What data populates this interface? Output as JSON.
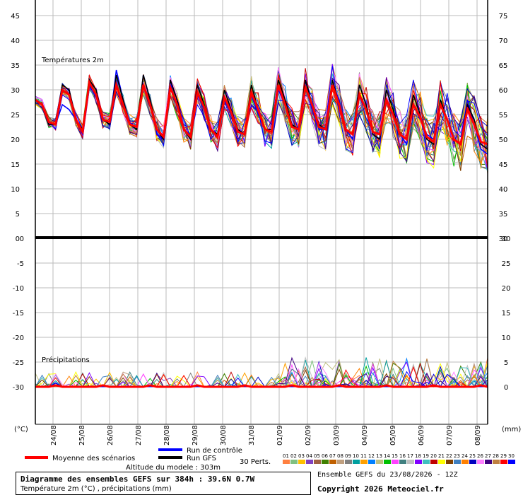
{
  "chart_data": [
    {
      "type": "line",
      "title": "Températures 2m",
      "ylim_left": [
        0,
        45
      ],
      "ylim_right": [
        30,
        75
      ],
      "yticks_left": [
        "45",
        "40",
        "35",
        "30",
        "25",
        "20",
        "15",
        "10",
        "5",
        "0"
      ],
      "yticks_right": [
        "75",
        "70",
        "65",
        "60",
        "55",
        "50",
        "45",
        "40",
        "35",
        "30"
      ],
      "categories": [
        "24/08",
        "25/08",
        "26/08",
        "27/08",
        "28/08",
        "29/08",
        "30/08",
        "31/08",
        "01/09",
        "02/09",
        "03/09",
        "04/09",
        "05/09",
        "06/09",
        "07/09",
        "08/09"
      ],
      "x_unit_hours": 6,
      "x_start": 0,
      "series": [
        {
          "name": "Moyenne des scénarios",
          "color": "#ff0000",
          "values": [
            28,
            27,
            23.5,
            23,
            30,
            29,
            24,
            21.5,
            31.5,
            29,
            24,
            23.5,
            31,
            27,
            23,
            22.5,
            31,
            27,
            22,
            20.5,
            30.5,
            27,
            22,
            20.5,
            29.5,
            26.5,
            22,
            20.5,
            28.5,
            25.5,
            21.5,
            21,
            29.5,
            26,
            22,
            21.5,
            31,
            27,
            22.5,
            22,
            30.5,
            27,
            22.5,
            22,
            31,
            27,
            22,
            21,
            29,
            26,
            21.5,
            21,
            28,
            25,
            21,
            20,
            27,
            24.5,
            20.5,
            19.5,
            27,
            24,
            20,
            19,
            26,
            23,
            19.5,
            19
          ]
        },
        {
          "name": "Run de contrôle",
          "color": "#0000ff",
          "values": [
            28,
            27,
            23,
            23,
            27,
            26,
            24,
            21,
            32,
            29,
            24,
            23,
            34,
            28,
            23,
            22,
            33,
            28,
            21,
            20,
            31,
            27,
            22,
            21,
            29,
            26,
            22,
            21,
            28,
            25,
            22,
            21,
            29,
            25,
            22,
            22,
            30,
            27,
            23,
            22,
            31,
            26,
            22,
            22,
            31,
            28,
            22,
            20,
            31,
            27,
            21,
            20,
            28,
            25,
            21,
            19,
            27,
            24,
            21,
            20,
            28,
            24,
            20,
            19,
            28,
            23,
            18,
            17
          ]
        },
        {
          "name": "Run GFS",
          "color": "#000000",
          "values": [
            28,
            27,
            23,
            23,
            31,
            30,
            24,
            22,
            32,
            30,
            24,
            23,
            33,
            28,
            23,
            22,
            33,
            28,
            22,
            20,
            32,
            28,
            22,
            20,
            31,
            27,
            22,
            21,
            30,
            26,
            22,
            21,
            31,
            26,
            22,
            22,
            32,
            28,
            23,
            22,
            32,
            27,
            23,
            22,
            32,
            27,
            22,
            21,
            31,
            27,
            21,
            20,
            30,
            26,
            21,
            20,
            29,
            25,
            20,
            19,
            28,
            24,
            20,
            19,
            27,
            24,
            19,
            18
          ]
        }
      ],
      "members": 30
    },
    {
      "type": "line",
      "title": "Précipitations",
      "ylim_left": [
        -35,
        0
      ],
      "ylim_right": [
        -5,
        30
      ],
      "yticks_left": [
        "0",
        "-5",
        "-10",
        "-15",
        "-20",
        "-25",
        "-30"
      ],
      "yticks_right": [
        "30",
        "25",
        "20",
        "15",
        "10",
        "5",
        "0"
      ],
      "xlabel_left": "(°C)",
      "xlabel_right": "(mm)"
    }
  ],
  "legend": {
    "mean": "Moyenne des scénarios",
    "control": "Run de contrôle",
    "gfs": "Run GFS",
    "perts": "30 Perts.",
    "altitude": "Altitude du modele : 303m",
    "member_numbers": [
      "01",
      "02",
      "03",
      "04",
      "05",
      "06",
      "07",
      "08",
      "09",
      "10",
      "11",
      "12",
      "13",
      "14",
      "15",
      "16",
      "17",
      "18",
      "19",
      "20",
      "21",
      "22",
      "23",
      "24",
      "25",
      "26",
      "27",
      "28",
      "29",
      "30"
    ],
    "member_colors": [
      "#ff8040",
      "#80c080",
      "#ffc000",
      "#8040c0",
      "#a06040",
      "#408000",
      "#c06000",
      "#c0a080",
      "#808080",
      "#00a0a0",
      "#ffa000",
      "#0080ff",
      "#c0c080",
      "#00c000",
      "#ff40ff",
      "#408080",
      "#c0c0c0",
      "#8000ff",
      "#40c0c0",
      "#c00000",
      "#ffff00",
      "#804000",
      "#4080c0",
      "#ff8000",
      "#0000c0",
      "#ff80ff",
      "#400080",
      "#c08040",
      "#ff0000",
      "#0000ff"
    ]
  },
  "footer": {
    "title": "Diagramme des ensembles GEFS sur 384h : 39.6N 0.7W",
    "subtitle": "Température 2m (°C) , précipitations (mm)",
    "run": "Ensemble GEFS du 23/08/2026 - 12Z",
    "copyright": "Copyright 2026 Meteociel.fr"
  }
}
